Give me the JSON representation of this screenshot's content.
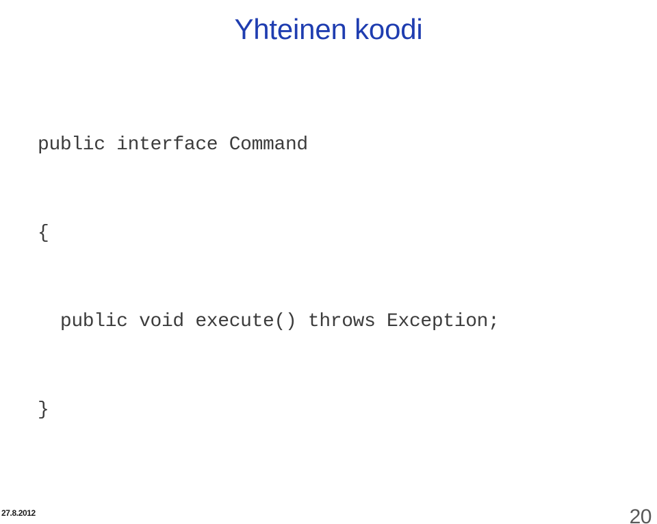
{
  "slide": {
    "title": "Yhteinen koodi",
    "title_color": "#1F3DB0",
    "background_color": "#FFFFFF"
  },
  "code": {
    "language": "java",
    "text_color": "#3C3C3C",
    "lines": [
      "public interface Command",
      "{",
      "  public void execute() throws Exception;",
      "}"
    ],
    "line_0": "public interface Command",
    "line_1": "{",
    "line_2": "  public void execute() throws Exception;",
    "line_3": "}"
  },
  "footer": {
    "date": "27.8.2012",
    "page_number": "20",
    "page_number_color": "#595959"
  }
}
